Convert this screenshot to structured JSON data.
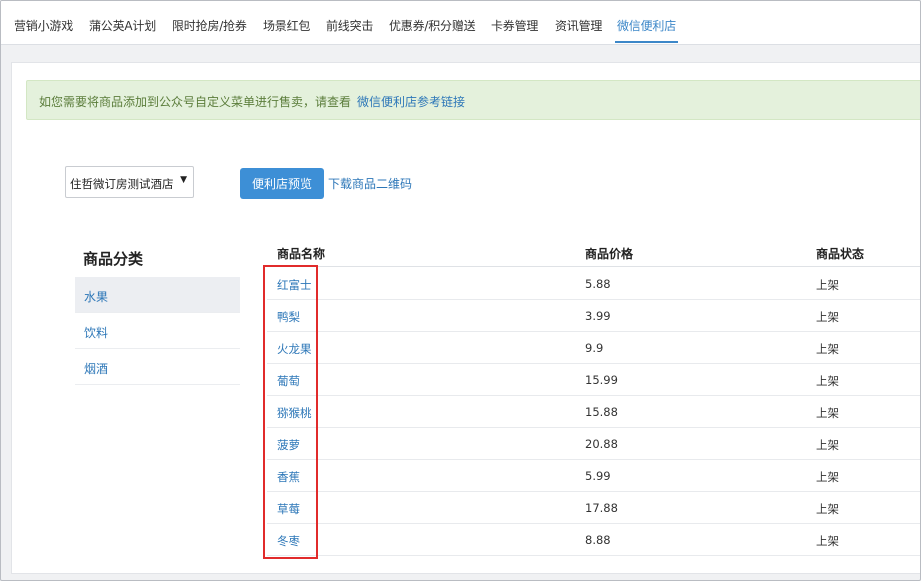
{
  "topnav": {
    "tabs": [
      {
        "label": "营销小游戏"
      },
      {
        "label": "蒲公英A计划"
      },
      {
        "label": "限时抢房/抢券"
      },
      {
        "label": "场景红包"
      },
      {
        "label": "前线突击"
      },
      {
        "label": "优惠券/积分赠送"
      },
      {
        "label": "卡券管理"
      },
      {
        "label": "资讯管理"
      },
      {
        "label": "微信便利店",
        "active": true
      }
    ]
  },
  "notice": {
    "message": "如您需要将商品添加到公众号自定义菜单进行售卖，请查看",
    "link": "微信便利店参考链接"
  },
  "toolbar": {
    "store_select": "住哲微订房测试酒店",
    "preview_button": "便利店预览",
    "download_link": "下载商品二维码"
  },
  "categories": {
    "title": "商品分类",
    "items": [
      {
        "label": "水果",
        "active": true
      },
      {
        "label": "饮料"
      },
      {
        "label": "烟酒"
      }
    ]
  },
  "table": {
    "headers": {
      "name": "商品名称",
      "price": "商品价格",
      "status": "商品状态"
    },
    "rows": [
      {
        "name": "红富士",
        "price": "5.88",
        "status": "上架"
      },
      {
        "name": "鸭梨",
        "price": "3.99",
        "status": "上架"
      },
      {
        "name": "火龙果",
        "price": "9.9",
        "status": "上架"
      },
      {
        "name": "葡萄",
        "price": "15.99",
        "status": "上架"
      },
      {
        "name": "猕猴桃",
        "price": "15.88",
        "status": "上架"
      },
      {
        "name": "菠萝",
        "price": "20.88",
        "status": "上架"
      },
      {
        "name": "香蕉",
        "price": "5.99",
        "status": "上架"
      },
      {
        "name": "草莓",
        "price": "17.88",
        "status": "上架"
      },
      {
        "name": "冬枣",
        "price": "8.88",
        "status": "上架"
      }
    ]
  },
  "colors": {
    "accent": "#3c87c8",
    "highlight": "#e12b2b",
    "notice_bg": "#e4f1dc"
  }
}
